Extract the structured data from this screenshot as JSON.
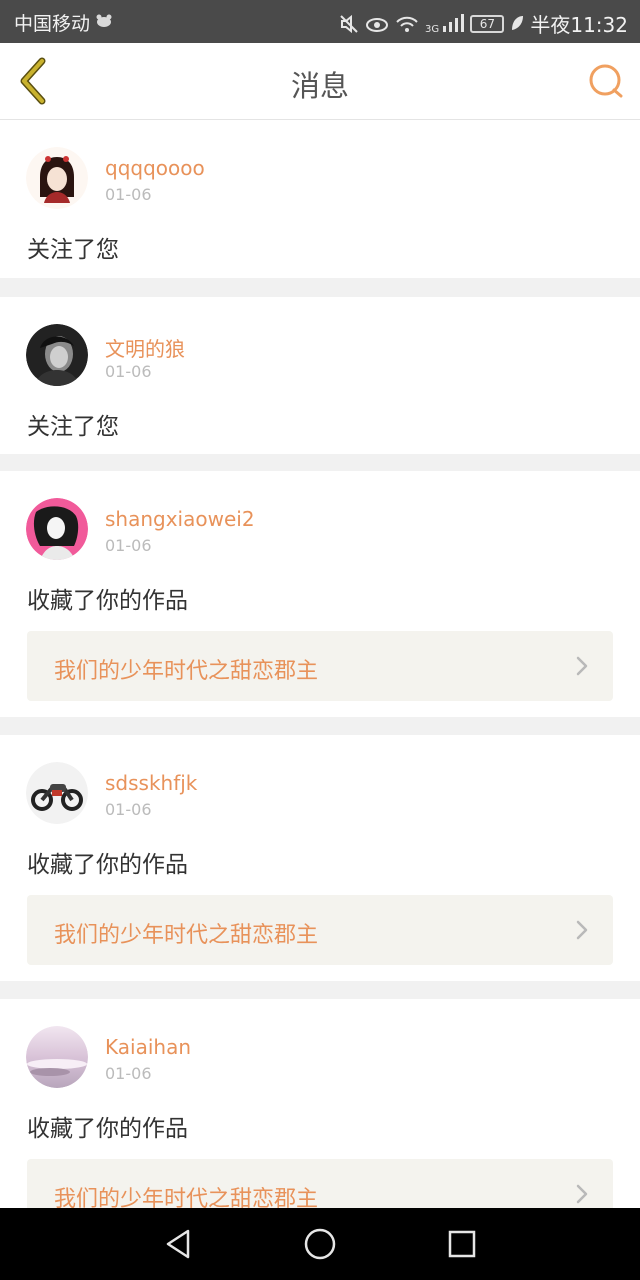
{
  "status_bar": {
    "carrier": "中国移动",
    "network_label": "3G",
    "battery": "67",
    "time": "半夜11:32",
    "icons": [
      "mute-icon",
      "eye-icon",
      "wifi-icon",
      "signal-icon",
      "battery-icon",
      "leaf-icon"
    ]
  },
  "header": {
    "title": "消息",
    "back_icon": "chevron-left-icon",
    "right_icon": "chat-bubble-icon"
  },
  "colors": {
    "accent": "#e8925a",
    "back_icon": "#c9b22e",
    "card_bg": "#ffffff",
    "page_bg": "#f1f1f1",
    "work_bg": "#f4f3ee"
  },
  "messages": [
    {
      "user": "qqqqoooo",
      "date": "01-06",
      "action": "关注了您"
    },
    {
      "user": "文明的狼",
      "date": "01-06",
      "action": "关注了您"
    },
    {
      "user": "shangxiaowei2",
      "date": "01-06",
      "action": "收藏了你的作品",
      "work": "我们的少年时代之甜恋郡主"
    },
    {
      "user": "sdsskhfjk",
      "date": "01-06",
      "action": "收藏了你的作品",
      "work": "我们的少年时代之甜恋郡主"
    },
    {
      "user": "Kaiaihan",
      "date": "01-06",
      "action": "收藏了你的作品",
      "work": "我们的少年时代之甜恋郡主"
    }
  ],
  "nav_bar": {
    "icons": [
      "back-triangle-icon",
      "home-circle-icon",
      "recents-square-icon"
    ]
  }
}
